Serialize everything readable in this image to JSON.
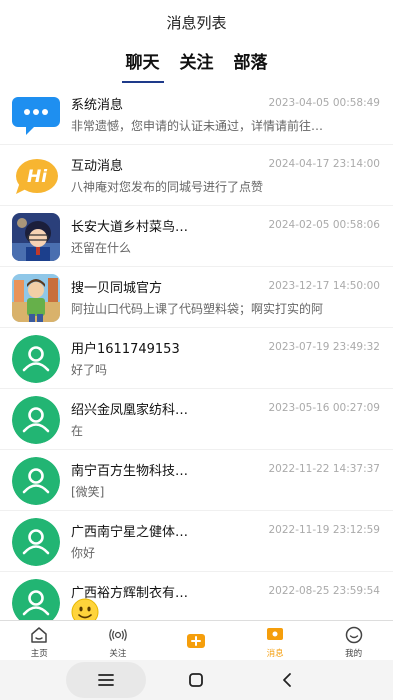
{
  "header": {
    "title": "消息列表",
    "tabs": [
      {
        "label": "聊天",
        "active": true
      },
      {
        "label": "关注",
        "active": false
      },
      {
        "label": "部落",
        "active": false
      }
    ]
  },
  "messages": [
    {
      "name": "系统消息",
      "time": "2023-04-05 00:58:49",
      "preview": "非常遗憾，您申请的认证未通过，详情请前往…",
      "avatar": "system-chat-bubble-icon"
    },
    {
      "name": "互动消息",
      "time": "2024-04-17 23:14:00",
      "preview": "八神庵对您发布的同城号进行了点赞",
      "avatar": "hi-bubble-icon"
    },
    {
      "name": "长安大道乡村菜鸟…",
      "time": "2024-02-05 00:58:06",
      "preview": "还留在什么",
      "avatar": "anime-character-photo"
    },
    {
      "name": "搜一贝同城官方",
      "time": "2023-12-17 14:50:00",
      "preview": "阿拉山口代码上课了代码塑料袋；啊实打实的阿",
      "avatar": "cartoon-figure-photo"
    },
    {
      "name": "用户1611749153",
      "time": "2023-07-19 23:49:32",
      "preview": "好了吗",
      "avatar": "default-user-icon"
    },
    {
      "name": "绍兴金凤凰家纺科…",
      "time": "2023-05-16 00:27:09",
      "preview": "在",
      "avatar": "default-user-icon"
    },
    {
      "name": "南宁百方生物科技…",
      "time": "2022-11-22 14:37:37",
      "preview": "[微笑]",
      "avatar": "default-user-icon"
    },
    {
      "name": "广西南宁星之健体…",
      "time": "2022-11-19 23:12:59",
      "preview": "你好",
      "avatar": "default-user-icon"
    },
    {
      "name": "广西裕方辉制衣有…",
      "time": "2022-08-25 23:59:54",
      "preview": "",
      "avatar": "default-user-icon",
      "emoji": "smile-emoji"
    }
  ],
  "tabbar": [
    {
      "label": "主页",
      "icon": "home-icon",
      "active": false
    },
    {
      "label": "关注",
      "icon": "broadcast-icon",
      "active": false
    },
    {
      "label": "",
      "icon": "publish-plus-icon",
      "active": false
    },
    {
      "label": "消息",
      "icon": "message-icon",
      "active": true
    },
    {
      "label": "我的",
      "icon": "profile-face-icon",
      "active": false
    }
  ],
  "colors": {
    "accent": "#f59e0b",
    "tab_underline": "#1e3a8a",
    "avatar_green": "#22b573",
    "system_blue": "#1e8ff0",
    "hi_orange": "#f7b531"
  }
}
